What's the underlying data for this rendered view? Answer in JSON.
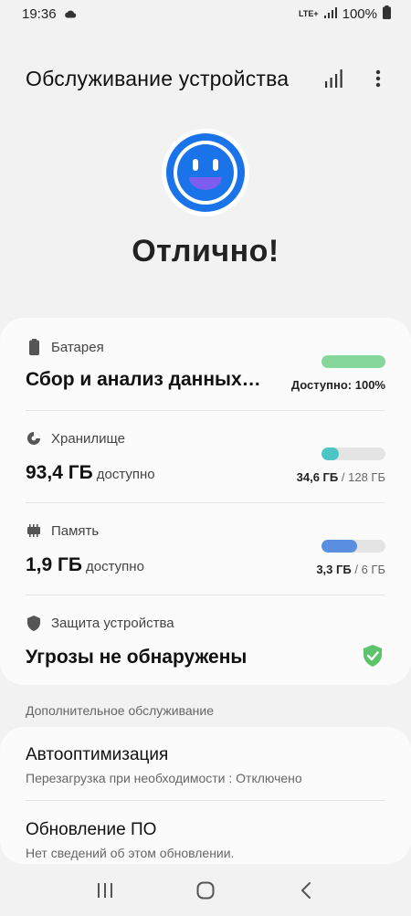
{
  "status_bar": {
    "time": "19:36",
    "network": "LTE+",
    "battery_level": "100%",
    "icons": [
      "cloud-icon",
      "signal-icon",
      "battery-icon"
    ]
  },
  "header": {
    "title": "Обслуживание устройства",
    "actions": [
      "stats-icon",
      "more-options-icon"
    ]
  },
  "overall": {
    "status": "Отлично!",
    "face_icon": "smiley-face-icon",
    "accent_color": "#1a73e8"
  },
  "battery": {
    "label": "Батарея",
    "value": "Сбор и анализ данных…",
    "available_label": "Доступно: 100%",
    "level": 1.0,
    "bar_color": "#86d89a"
  },
  "storage": {
    "label": "Хранилище",
    "value": "93,4 ГБ",
    "unit": "доступно",
    "used": "34,6 ГБ",
    "total": "/ 128 ГБ",
    "fraction": 0.27,
    "bar_color": "#4cc6c4"
  },
  "memory": {
    "label": "Память",
    "value": "1,9 ГБ",
    "unit": "доступно",
    "used": "3,3 ГБ",
    "total": "/ 6 ГБ",
    "fraction": 0.55,
    "bar_color": "#5a8fe0"
  },
  "protection": {
    "label": "Защита устройства",
    "value": "Угрозы не обнаружены",
    "status_color": "#5cc46a"
  },
  "extra_section": {
    "label": "Дополнительное обслуживание",
    "items": [
      {
        "title": "Автооптимизация",
        "subtitle": "Перезагрузка при необходимости : Отключено"
      },
      {
        "title": "Обновление ПО",
        "subtitle": "Нет сведений об этом обновлении."
      }
    ]
  },
  "nav_bar": {
    "buttons": [
      "recent-apps-icon",
      "home-icon",
      "back-icon"
    ]
  }
}
